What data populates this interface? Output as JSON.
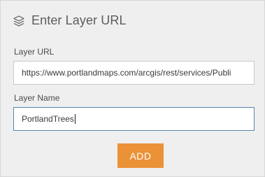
{
  "header": {
    "icon": "layers-icon",
    "title": "Enter Layer URL"
  },
  "form": {
    "url_label": "Layer URL",
    "url_value": "https://www.portlandmaps.com/arcgis/rest/services/Publi",
    "name_label": "Layer Name",
    "name_value": "PortlandTrees"
  },
  "actions": {
    "add_label": "ADD",
    "add_color": "#eb9136"
  }
}
